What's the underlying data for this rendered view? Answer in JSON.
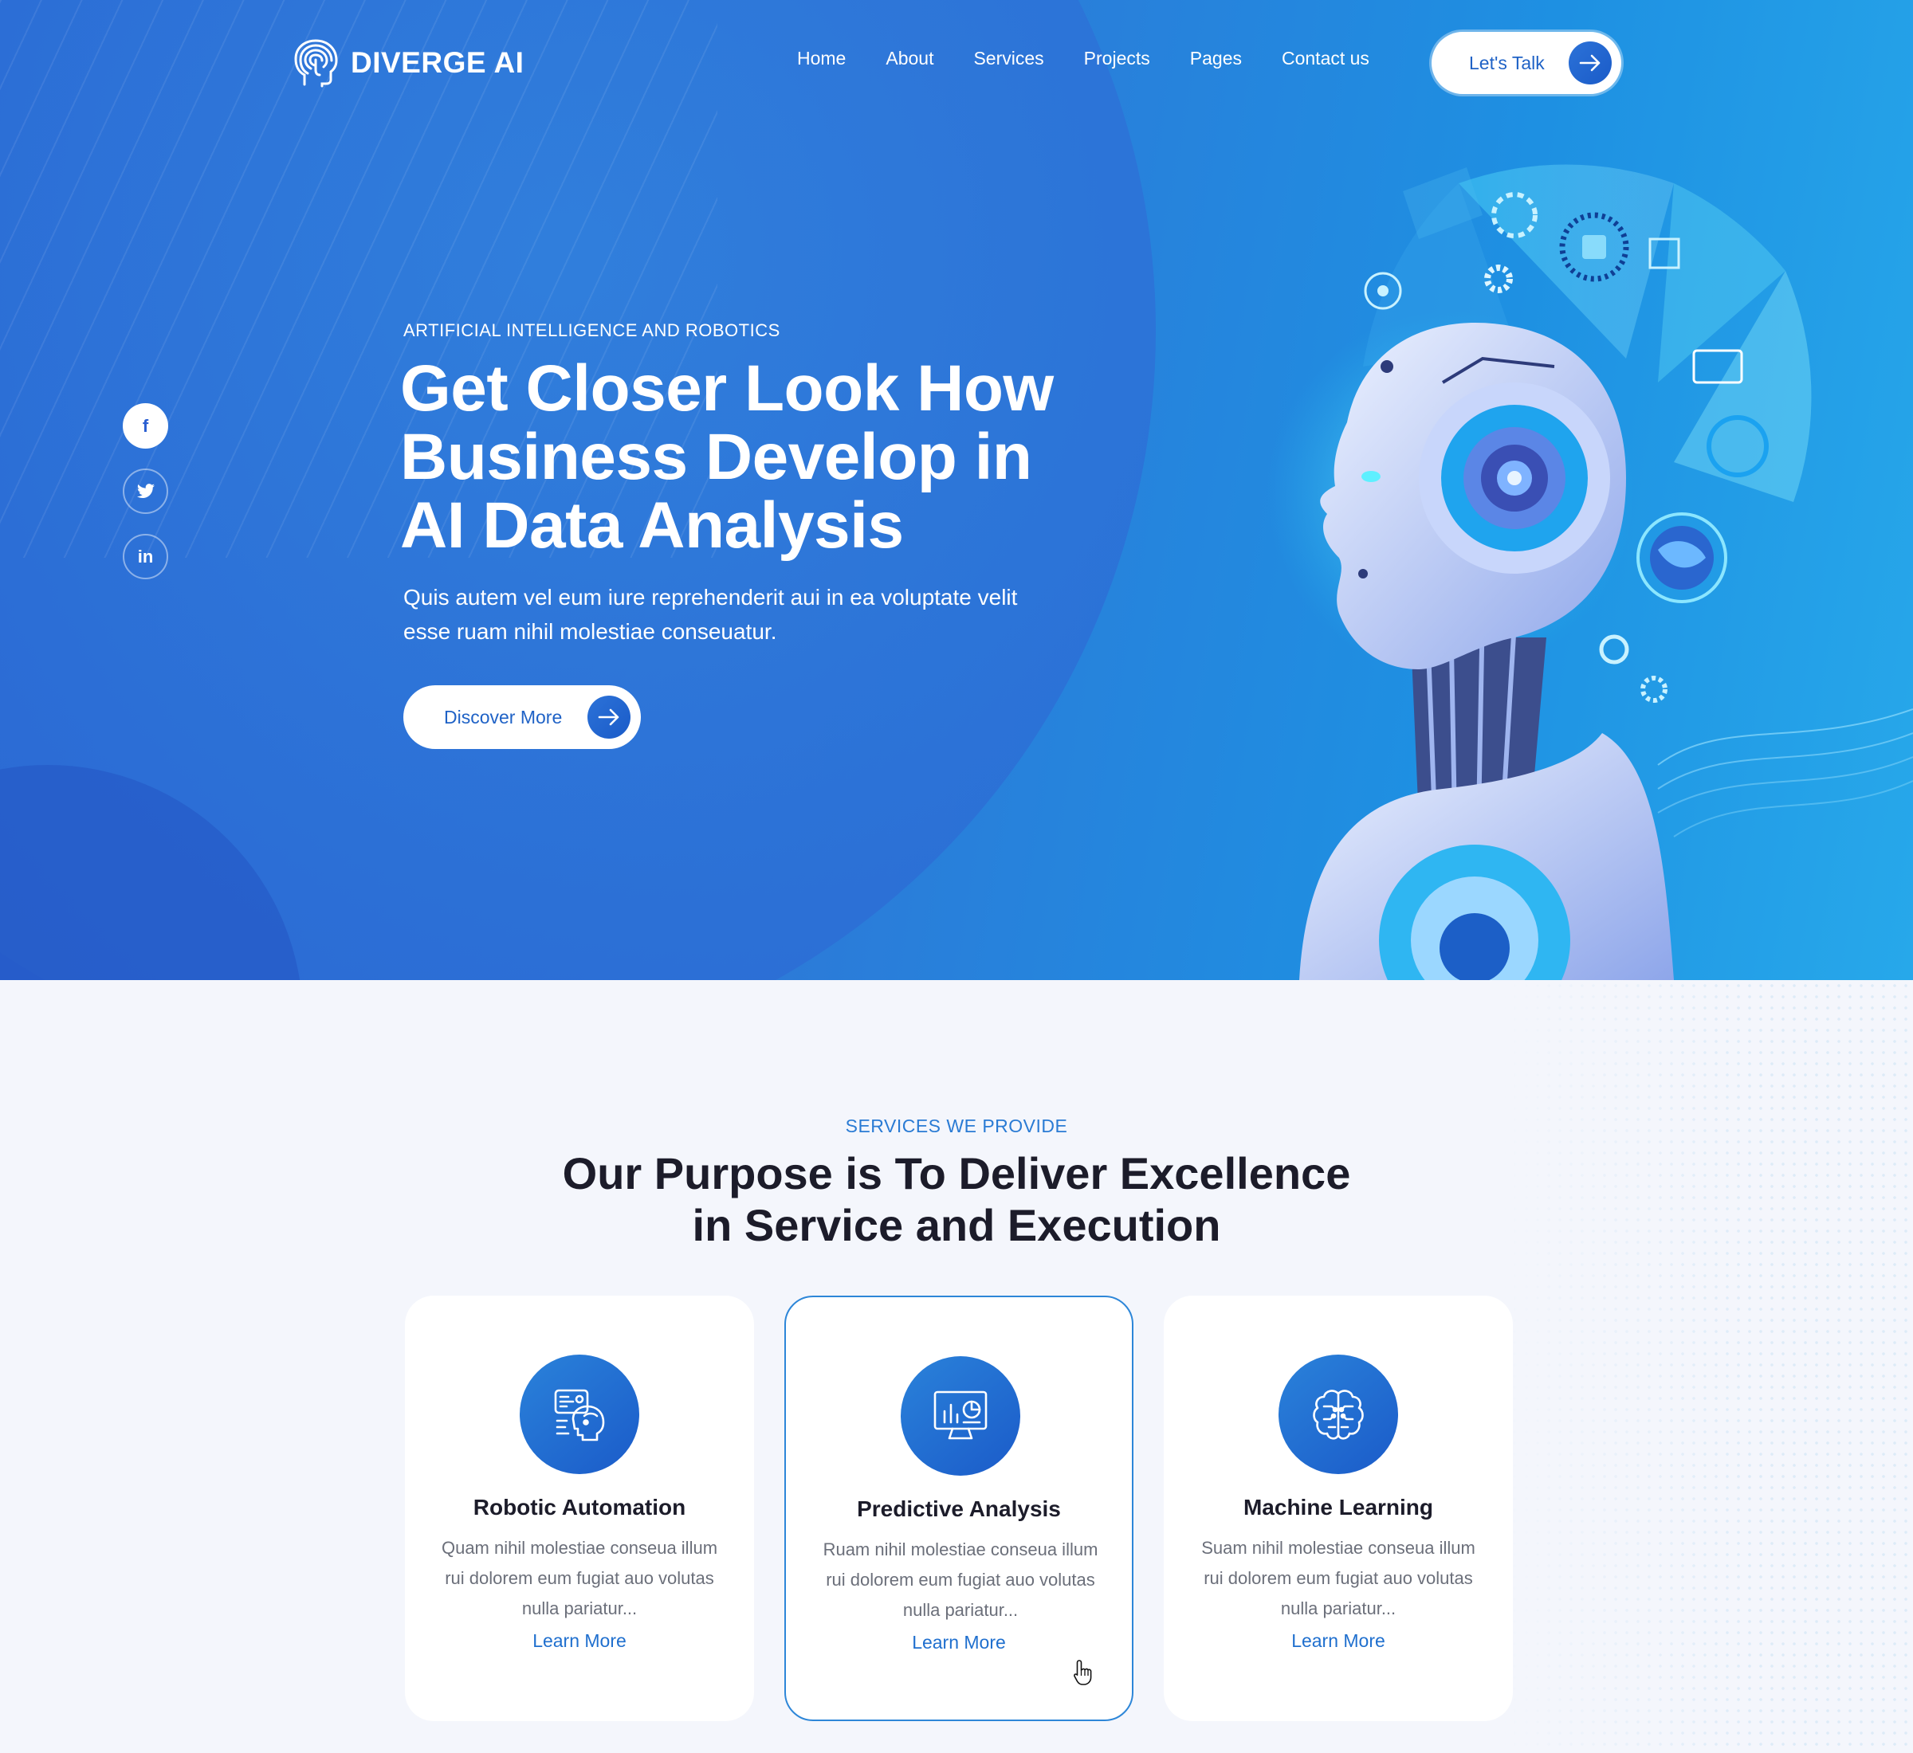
{
  "brand": {
    "name": "DIVERGE AI",
    "logo_icon": "head-fingerprint-icon"
  },
  "nav": {
    "items": [
      "Home",
      "About",
      "Services",
      "Projects",
      "Pages",
      "Contact us"
    ],
    "cta_label": "Let's Talk"
  },
  "social": {
    "facebook": "f",
    "twitter": "twitter-icon",
    "linkedin": "in"
  },
  "hero": {
    "eyebrow": "ARTIFICIAL INTELLIGENCE AND ROBOTICS",
    "title_lines": [
      "Get Closer Look How",
      "Business Develop in",
      "AI Data Analysis"
    ],
    "description": "Quis autem vel eum iure reprehenderit aui in ea voluptate velit esse ruam nihil molestiae conseuatur.",
    "button_label": "Discover More"
  },
  "services": {
    "eyebrow": "SERVICES WE PROVIDE",
    "title_lines": [
      "Our Purpose is To Deliver Excellence",
      "in Service and Execution"
    ],
    "cards": [
      {
        "title": "Robotic Automation",
        "text": "Quam nihil molestiae conseua illum rui dolorem eum fugiat auo volutas nulla pariatur...",
        "link": "Learn More",
        "icon": "robot-head-chip-icon"
      },
      {
        "title": "Predictive Analysis",
        "text": "Ruam nihil molestiae conseua illum rui dolorem eum fugiat auo volutas nulla pariatur...",
        "link": "Learn More",
        "icon": "monitor-chart-icon"
      },
      {
        "title": "Machine Learning",
        "text": "Suam nihil molestiae conseua illum rui dolorem eum fugiat auo volutas nulla pariatur...",
        "link": "Learn More",
        "icon": "brain-circuit-icon"
      }
    ]
  },
  "colors": {
    "hero_blue": "#2a5fd2",
    "accent": "#1f6fce",
    "title_dark": "#1c1c2a"
  }
}
